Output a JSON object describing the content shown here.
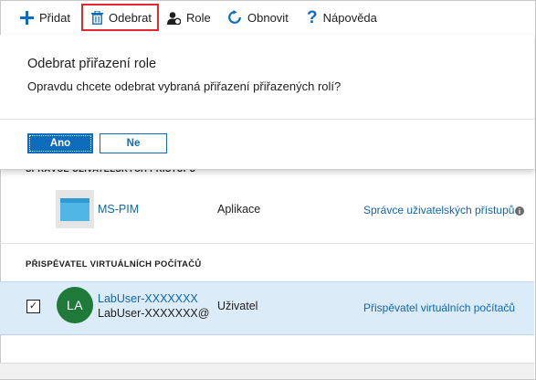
{
  "toolbar": {
    "add_label": "Přidat",
    "remove_label": "Odebrat",
    "role_label": "Role",
    "refresh_label": "Obnovit",
    "help_label": "Nápověda",
    "colors": {
      "add_icon": "#0f6cbd",
      "remove_highlight": "#e0282e"
    }
  },
  "dialog": {
    "title": "Odebrat přiřazení role",
    "message": "Opravdu chcete odebrat vybraná přiřazení přiřazených rolí?",
    "yes_label": "Ano",
    "no_label": "Ne"
  },
  "sections": [
    {
      "heading": "SPRÁVCE UŽIVATELSKÝCH PŘÍSTUPŮ",
      "rows": [
        {
          "name": "MS-PIM",
          "type": "Aplikace",
          "role": "Správce uživatelských přístupů",
          "icon": "app-tile-icon"
        }
      ]
    },
    {
      "heading": "PŘISPĚVATEL VIRTUÁLNÍCH POČÍTAČŮ",
      "rows": [
        {
          "avatar_initials": "LA",
          "name": "LabUser-XXXXXXX",
          "subname": "LabUser-XXXXXXX@",
          "type": "Uživatel",
          "role": "Přispěvatel virtuálních počítačů",
          "selected": true,
          "avatar_color": "#1f7a3a"
        }
      ]
    }
  ]
}
